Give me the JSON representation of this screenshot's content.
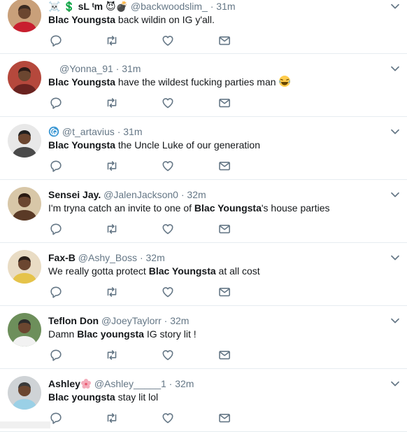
{
  "tweets": [
    {
      "name": "",
      "name_decoration": "☠️ 💲 sL ᵗm 😈💣",
      "handle": "@backwoodslim_",
      "sep": "·",
      "time": "31m",
      "mention": "Blac Youngsta",
      "text_before": "",
      "text_after": " back wildin on IG y'all.",
      "avatar_colors": [
        "#c9a07a",
        "#c81f2f",
        "#3a2a22"
      ]
    },
    {
      "name": "",
      "handle": "@Yonna_91",
      "sep": "·",
      "time": "31m",
      "mention": "Blac Youngsta",
      "text_before": "",
      "text_after": " have the wildest fucking parties man",
      "trailing_emoji": "laughing-emoji",
      "avatar_colors": [
        "#b5483c",
        "#6a2320",
        "#2b1a16"
      ]
    },
    {
      "name": "",
      "handle": "@t_artavius",
      "sep": "·",
      "time": "31m",
      "mention": "Blac Youngsta",
      "text_before": "",
      "text_after": " the Uncle Luke of our generation",
      "avatar_colors": [
        "#e8e8e8",
        "#4a4a4a",
        "#1f1f1f"
      ]
    },
    {
      "name": "Sensei Jay.",
      "handle": "@JalenJackson0",
      "sep": "·",
      "time": "32m",
      "mention": "Blac Youngsta",
      "text_before": "I'm tryna catch an invite to one of ",
      "text_after": "'s house parties",
      "avatar_colors": [
        "#d8c7a8",
        "#5a3a26",
        "#2a1a12"
      ]
    },
    {
      "name": "Fax-B",
      "handle": "@Ashy_Boss",
      "sep": "·",
      "time": "32m",
      "mention": "Blac Youngsta",
      "text_before": "We really gotta protect ",
      "text_after": " at all cost",
      "avatar_colors": [
        "#e9dcc4",
        "#e5c34a",
        "#2a1f18"
      ]
    },
    {
      "name": "Teflon Don",
      "handle": "@JoeyTaylorr",
      "sep": "·",
      "time": "32m",
      "mention": "Blac youngsta",
      "text_before": "Damn ",
      "text_after": " IG story lit !",
      "avatar_colors": [
        "#6d8f5b",
        "#f2f2f2",
        "#2a2a2a"
      ]
    },
    {
      "name": "Ashley",
      "name_emoji": "blossom-emoji",
      "handle": "@Ashley_____1",
      "sep": "·",
      "time": "32m",
      "mention": "Blac youngsta",
      "text_before": "",
      "text_after": " stay lit lol",
      "avatar_colors": [
        "#cfd3d6",
        "#9ad0e6",
        "#3a3a3a"
      ]
    }
  ],
  "icons": {
    "reply": "reply-icon",
    "retweet": "retweet-icon",
    "like": "heart-icon",
    "dm": "envelope-icon",
    "caret": "chevron-down-icon",
    "verified_style": "swirl-icon"
  },
  "colors": {
    "icon": "#657786",
    "text": "#14171a",
    "muted": "#657786",
    "divider": "#e6ecf0"
  }
}
